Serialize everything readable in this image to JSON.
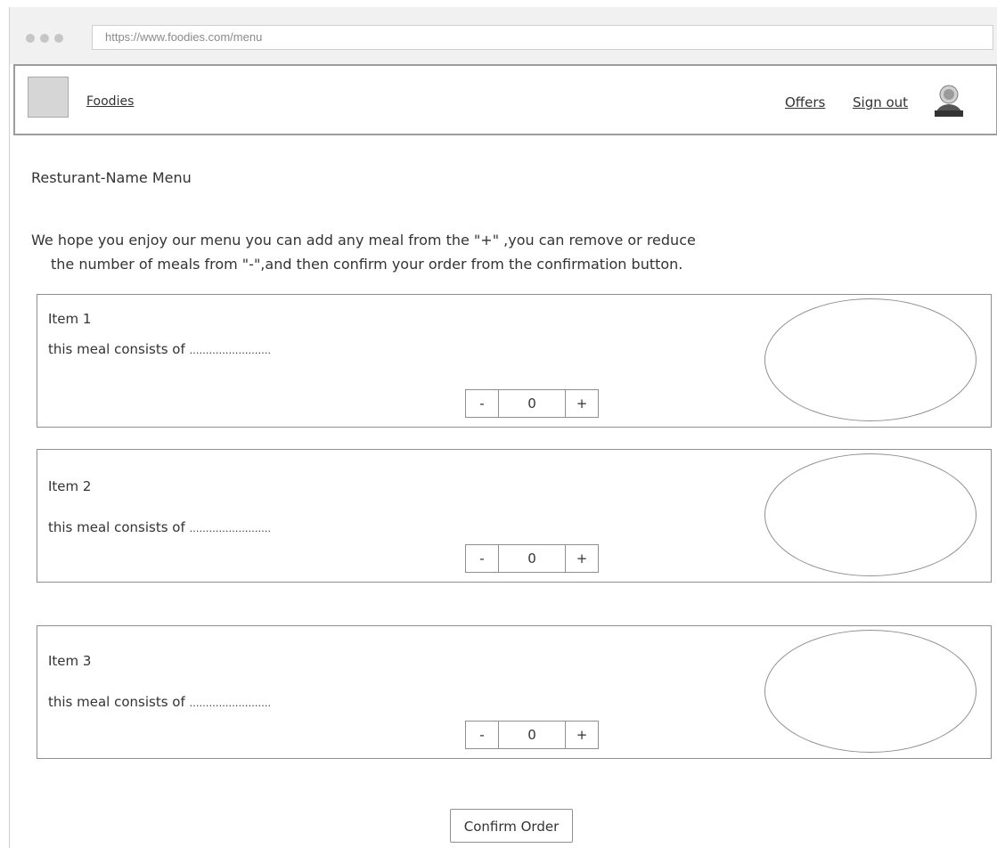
{
  "browser": {
    "url": "https://www.foodies.com/menu"
  },
  "navbar": {
    "brand": "Foodies",
    "links": [
      "Offers",
      "Sign out"
    ],
    "user_icon": "user-avatar-icon"
  },
  "page": {
    "title": "Resturant-Name Menu",
    "intro_line1": "We hope you enjoy our menu you can add any meal from the \"+\" ,you can remove or reduce",
    "intro_line2": "the number of meals from \"-\",and then confirm your order from the confirmation button."
  },
  "items": [
    {
      "name": "Item 1",
      "description": "this meal consists of ",
      "dots": "…………………….",
      "quantity": "0",
      "minus": "-",
      "plus": "+"
    },
    {
      "name": "Item 2",
      "description": "this meal consists of ",
      "dots": "…………………….",
      "quantity": "0",
      "minus": "-",
      "plus": "+"
    },
    {
      "name": "Item 3",
      "description": "this meal consists of ",
      "dots": "…………………….",
      "quantity": "0",
      "minus": "-",
      "plus": "+"
    }
  ],
  "actions": {
    "confirm_label": "Confirm Order"
  }
}
